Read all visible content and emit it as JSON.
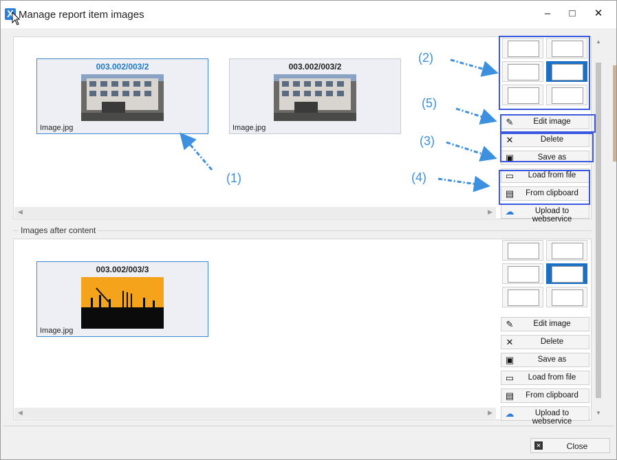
{
  "window": {
    "title": "Manage report item images",
    "app_icon": "X",
    "minimize": "–",
    "maximize": "□",
    "close": "✕"
  },
  "section1": {
    "images": [
      {
        "title": "003.002/003/2",
        "file": "Image.jpg",
        "selected": true,
        "thumb": "building-photo"
      },
      {
        "title": "003.002/003/2",
        "file": "Image.jpg",
        "selected": false,
        "thumb": "building-photo"
      }
    ]
  },
  "section2": {
    "caption": "Images after content",
    "images": [
      {
        "title": "003.002/003/3",
        "file": "Image.jpg",
        "selected": true,
        "thumb": "construction-sunset-photo"
      }
    ]
  },
  "actions": {
    "edit": "Edit image",
    "delete": "Delete",
    "save_as": "Save as",
    "load_file": "Load from file",
    "clipboard": "From clipboard",
    "upload": "Upload to webservice"
  },
  "icons": {
    "edit": "pencil-icon",
    "delete": "x-icon",
    "save_as": "floppy-icon",
    "load_file": "folder-icon",
    "clipboard": "clipboard-icon",
    "upload": "cloud-upload-icon"
  },
  "layouts": {
    "options": [
      "image-left-small",
      "image-right-small",
      "image-wide",
      "two-images",
      "grid-six",
      "grid-twelve"
    ],
    "active_index": 3
  },
  "annotations": [
    "(1)",
    "(2)",
    "(3)",
    "(4)",
    "(5)"
  ],
  "footer": {
    "close_label": "Close"
  },
  "colors": {
    "accent": "#1a70c4",
    "annotation": "#3d8fe0",
    "highlight_box": "#3a57e0",
    "selected_title": "#1f78c8"
  }
}
